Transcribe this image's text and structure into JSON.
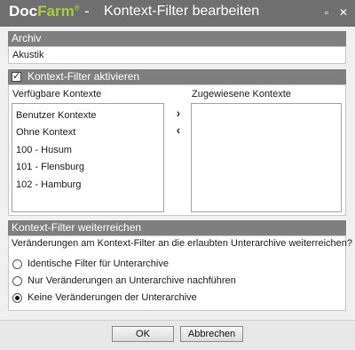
{
  "titlebar": {
    "logo_doc": "Doc",
    "logo_farm": "Farm",
    "logo_reg": "®",
    "separator": "-",
    "title": "Kontext-Filter bearbeiten",
    "restore_glyph": "▫",
    "close_glyph": "✕"
  },
  "archiv": {
    "header": "Archiv",
    "value": "Akustik"
  },
  "kontext": {
    "checkbox_label": "Kontext-Filter aktivieren",
    "checked": true,
    "available_label": "Verfügbare Kontexte",
    "assigned_label": "Zugewiesene Kontexte",
    "available_items": [
      "Benutzer Kontexte",
      "Ohne Kontext",
      "100 - Husum",
      "101 - Flensburg",
      "102 - Hamburg"
    ],
    "assigned_items": [],
    "move_right_glyph": "›",
    "move_left_glyph": "‹"
  },
  "weiterreichen": {
    "header": "Kontext-Filter weiterreichen",
    "question": "Veränderungen am Kontext-Filter an die erlaubten Unterarchive weiterreichen?",
    "options": [
      {
        "label": "Identische Filter für Unterarchive",
        "selected": false
      },
      {
        "label": "Nur Veränderungen an Unterarchive nachführen",
        "selected": false
      },
      {
        "label": "Keine Veränderungen der Unterarchive",
        "selected": true
      }
    ]
  },
  "footer": {
    "ok_label": "OK",
    "cancel_label": "Abbrechen"
  },
  "colors": {
    "titlebar_bg": "#6f6f6f",
    "section_header_bg": "#7f7f7f",
    "logo_accent": "#a9cc3d"
  }
}
